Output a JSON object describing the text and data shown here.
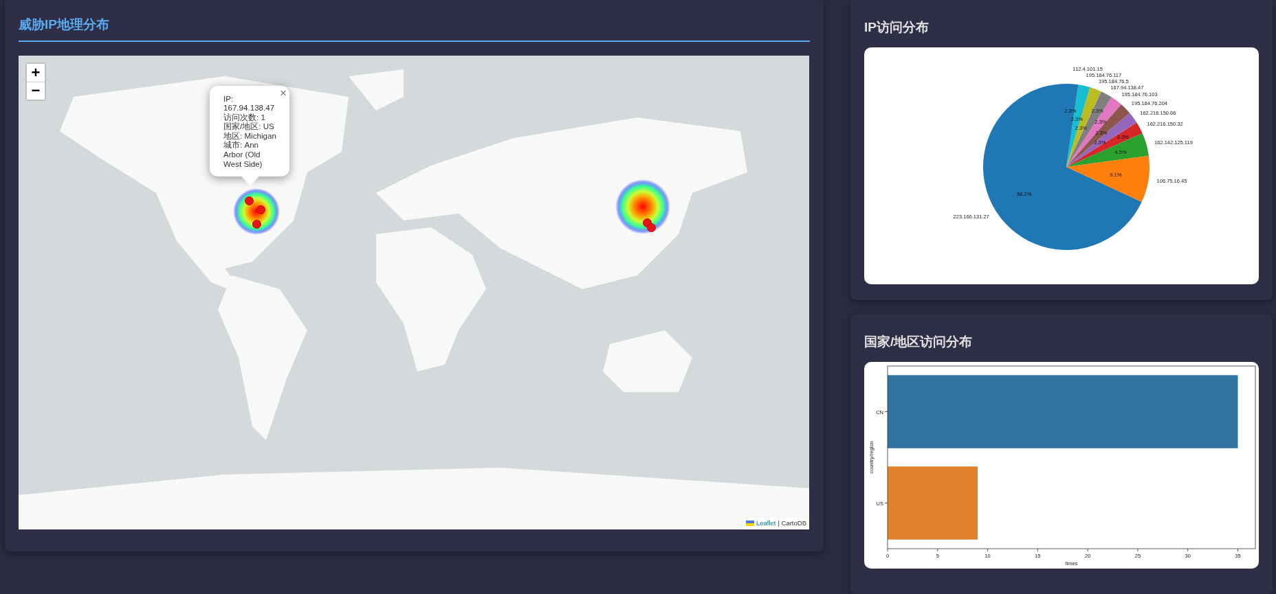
{
  "map_panel": {
    "title": "威胁IP地理分布",
    "zoom_buttons": [
      "+",
      "−"
    ],
    "popup": {
      "close": "×",
      "lines": [
        "IP: 167.94.138.47",
        "访问次数: 1",
        "国家/地区: US",
        "地区: Michigan",
        "城市: Ann Arbor (Old West Side)"
      ]
    },
    "attribution": {
      "link": "Leaflet",
      "text": "| CartoDB"
    }
  },
  "ip_panel": {
    "title": "IP访问分布",
    "chart_data": {
      "type": "pie",
      "categories": [
        "223.160.131.27",
        "106.75.16.45",
        "162.142.125.119",
        "162.216.150.32",
        "162.216.150.66",
        "195.184.76.204",
        "195.184.76.103",
        "167.94.138.47",
        "195.184.76.5",
        "195.184.76.117",
        "112.4.101.15"
      ],
      "values": [
        68.2,
        9.1,
        4.5,
        2.3,
        2.3,
        2.3,
        2.3,
        2.3,
        2.3,
        2.3,
        2.3
      ],
      "colors": [
        "#1f77b4",
        "#ff7f0e",
        "#2ca02c",
        "#d62728",
        "#9467bd",
        "#8c564b",
        "#e377c2",
        "#7f7f7f",
        "#bcbd22",
        "#17becf",
        "#1f77b4"
      ],
      "value_labels": [
        "68.2%",
        "9.1%",
        "4.5%",
        "2.3%",
        "2.3%",
        "2.3%",
        "2.3%",
        "2.3%",
        "2.3%",
        "2.3%",
        "2.3%"
      ]
    }
  },
  "country_panel": {
    "title": "国家/地区访问分布",
    "chart_data": {
      "type": "bar",
      "orientation": "horizontal",
      "xlabel": "times",
      "ylabel": "country/region",
      "categories": [
        "CN",
        "US"
      ],
      "values": [
        35,
        9
      ],
      "colors": [
        "#3274a1",
        "#e1812c"
      ],
      "xlim": [
        0,
        36.75
      ],
      "xticks": [
        0,
        5,
        10,
        15,
        20,
        25,
        30,
        35
      ]
    }
  }
}
